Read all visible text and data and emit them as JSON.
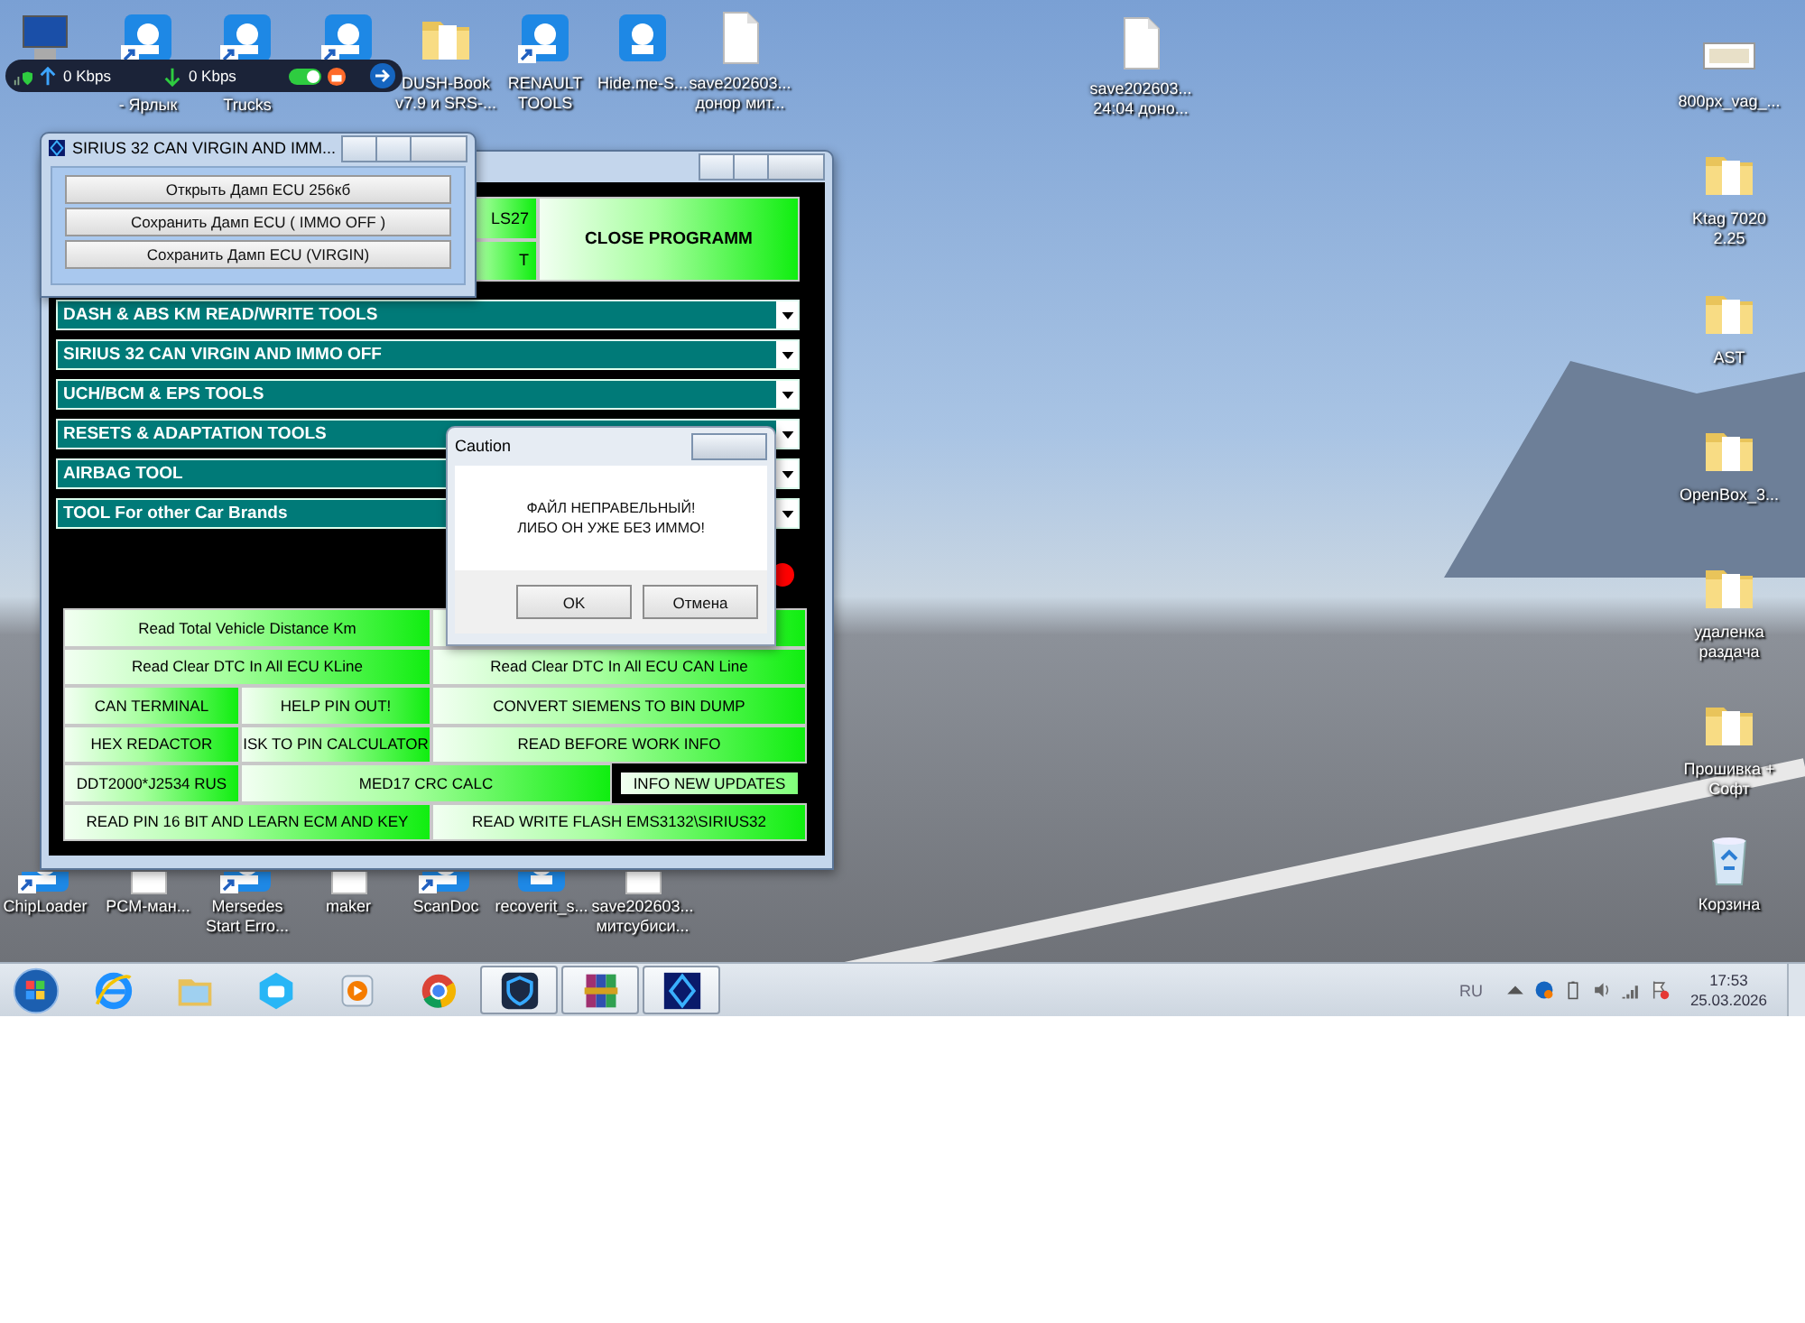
{
  "network_widget": {
    "upload": "0 Kbps",
    "download": "0 Kbps",
    "toggle_on": true
  },
  "desktop_icons": [
    {
      "kind": "computer",
      "shortcut": false
    },
    {
      "kind": "app",
      "label": "- Ярлык",
      "shortcut": true
    },
    {
      "kind": "app",
      "label": "Trucks",
      "shortcut": true
    },
    {
      "kind": "app",
      "shortcut": true
    },
    {
      "kind": "folder",
      "label": "DUSH-Book v7.9 и SRS-...",
      "shortcut": false
    },
    {
      "kind": "app",
      "label": "RENAULT TOOLS",
      "shortcut": true
    },
    {
      "kind": "app",
      "label": "Hide.me-S...",
      "shortcut": false
    },
    {
      "kind": "file",
      "label": "save202603... донор мит...",
      "shortcut": false
    },
    {
      "kind": "file",
      "label": "save202603... 24:04 доно...",
      "shortcut": false
    },
    {
      "kind": "image",
      "label": "800px_vag_...",
      "shortcut": false
    },
    {
      "kind": "folder",
      "label": "Ktag 7020 2.25",
      "shortcut": false
    },
    {
      "kind": "folder",
      "label": "AST",
      "shortcut": false
    },
    {
      "kind": "folder",
      "label": "OpenBox_3...",
      "shortcut": false
    },
    {
      "kind": "folder",
      "label": "удаленка раздача",
      "shortcut": false
    },
    {
      "kind": "folder",
      "label": "Прошивка + Софт",
      "shortcut": false
    },
    {
      "kind": "app",
      "label": "ChipLoader",
      "shortcut": true
    },
    {
      "kind": "file",
      "label": "PCM-ман...",
      "shortcut": false
    },
    {
      "kind": "app",
      "label": "Mersedes Start Erro...",
      "shortcut": true
    },
    {
      "kind": "file",
      "label": "maker",
      "shortcut": false
    },
    {
      "kind": "app",
      "label": "ScanDoc",
      "shortcut": true
    },
    {
      "kind": "app",
      "label": "recoverit_s...",
      "shortcut": false
    },
    {
      "kind": "file",
      "label": "save202603... митсубиси...",
      "shortcut": false
    },
    {
      "kind": "recycle",
      "label": "Корзина",
      "shortcut": false
    }
  ],
  "main_window": {
    "top_buttons": [
      "LS27",
      "T"
    ],
    "close_button": "CLOSE PROGRAMM",
    "dropdowns": [
      "DASH & ABS KM READ/WRITE TOOLS",
      "SIRIUS 32 CAN VIRGIN AND IMMO OFF",
      "UCH/BCM & EPS TOOLS",
      "RESETS & ADAPTATION TOOLS",
      "AIRBAG TOOL",
      "TOOL For other Car Brands"
    ],
    "buttons": [
      "Read Total Vehicle Distance Km",
      "Read Clear DTC In All ECU KLine",
      "Read Clear DTC In All ECU CAN Line",
      "CAN TERMINAL",
      "HELP PIN OUT!",
      "CONVERT SIEMENS TO BIN DUMP",
      "HEX REDACTOR",
      "ISK TO PIN CALCULATOR",
      "READ BEFORE WORK INFO",
      "DDT2000*J2534 RUS",
      "MED17 CRC CALC",
      "INFO NEW UPDATES",
      "READ PIN 16 BIT AND LEARN ECM AND KEY",
      "READ WRITE FLASH EMS3132\\SIRIUS32"
    ]
  },
  "small_window": {
    "title": "SIRIUS 32 CAN VIRGIN AND IMM...",
    "buttons": [
      "Открыть Дамп ECU 256кб",
      "Сохранить Дамп ECU ( IMMO OFF )",
      "Сохранить Дамп ECU (VIRGIN)"
    ]
  },
  "caution_dialog": {
    "title": "Caution",
    "message": "ФАЙЛ НЕПРАВЕЛЬНЫЙ!\nЛИБО ОН УЖЕ БЕЗ ИММО!",
    "buttons": [
      "OK",
      "Отмена"
    ]
  },
  "taskbar": {
    "items": [
      {
        "kind": "browser",
        "running": false
      },
      {
        "kind": "explorer",
        "running": false
      },
      {
        "kind": "hexagon",
        "running": false
      },
      {
        "kind": "media",
        "running": false
      },
      {
        "kind": "chrome",
        "running": false
      },
      {
        "kind": "shield",
        "running": true
      },
      {
        "kind": "archive",
        "running": true
      },
      {
        "kind": "diamond",
        "running": true
      }
    ],
    "language": "RU",
    "time": "17:53",
    "date": "25.03.2026"
  }
}
